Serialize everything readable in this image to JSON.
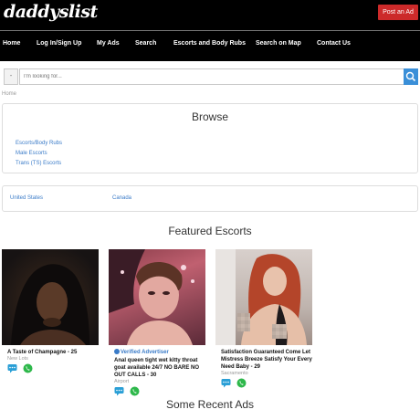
{
  "header": {
    "logo": "daddyslist",
    "post_ad": "Post an Ad",
    "nav": [
      "Home",
      "Log In/Sign Up",
      "My Ads",
      "Search",
      "Escorts and Body Rubs",
      "Search on Map",
      "Contact Us"
    ]
  },
  "search": {
    "dropdown": "-",
    "placeholder": "I'm looking for..."
  },
  "breadcrumb": "Home",
  "browse": {
    "title": "Browse",
    "links": [
      "Escorts/Body Rubs",
      "Male Escorts",
      "Trans (TS) Escorts"
    ]
  },
  "countries": [
    "United States",
    "Canada"
  ],
  "featured": {
    "title": "Featured Escorts",
    "cards": [
      {
        "verified": "",
        "title": "A Taste of Champagne - 25",
        "location": "New Lots"
      },
      {
        "verified": "Verified Advertiser",
        "title": "Anal queen tight wet kitty throat goat available 24/7 NO BARE NO OUT CALLS - 30",
        "location": "Airport"
      },
      {
        "verified": "",
        "title": "Satisfaction Guaranteed Come Let Mistress Breeze Satisfy Your Every Need Baby - 29",
        "location": "Sacramento"
      }
    ]
  },
  "recent": {
    "title": "Some Recent Ads"
  },
  "colors": {
    "accent": "#cc2a2a",
    "link": "#3a7bc8",
    "search_button": "#3a8fd8",
    "chat": "#2a9fd6",
    "phone": "#2eb84b"
  }
}
